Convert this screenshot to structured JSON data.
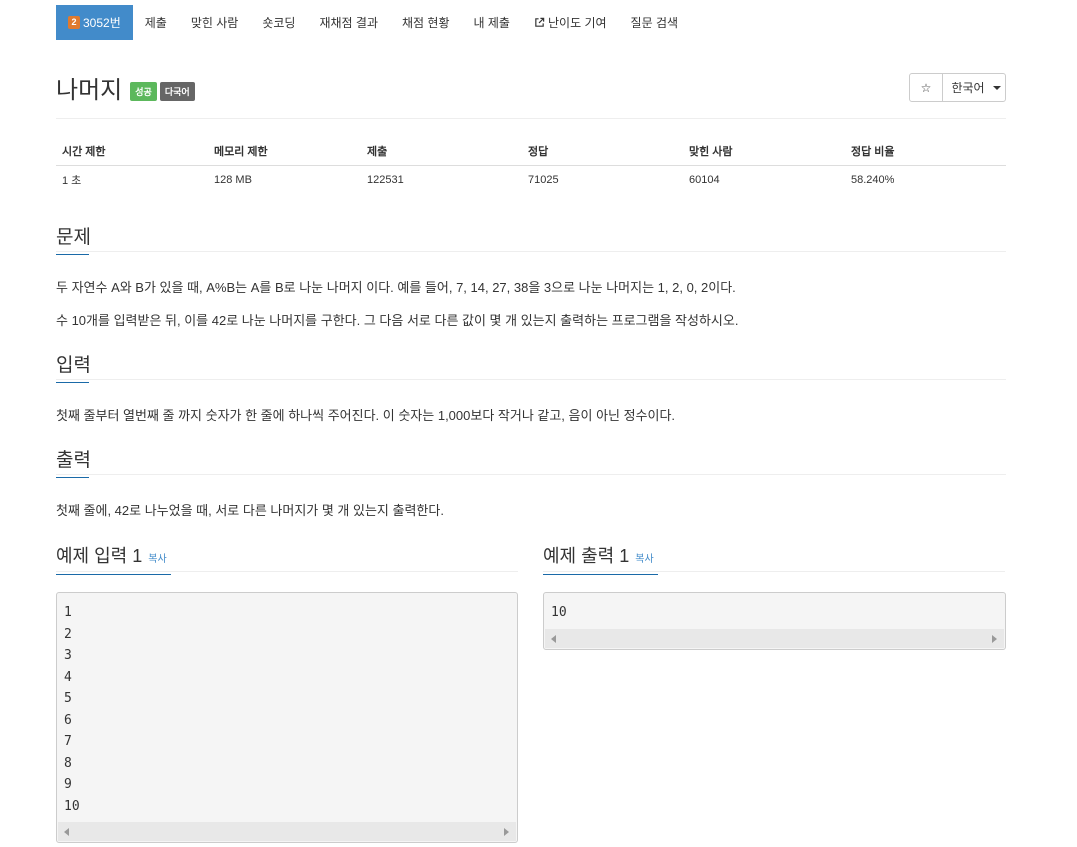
{
  "nav": {
    "problem_tab": "3052번",
    "medal_level": "2",
    "items": [
      "제출",
      "맞힌 사람",
      "숏코딩",
      "재채점 결과",
      "채점 현황",
      "내 제출",
      "난이도 기여",
      "질문 검색"
    ]
  },
  "problem": {
    "title": "나머지",
    "badge_success": "성공",
    "badge_multilang": "다국어",
    "star": "☆",
    "language": "한국어"
  },
  "stats": {
    "headers": [
      "시간 제한",
      "메모리 제한",
      "제출",
      "정답",
      "맞힌 사람",
      "정답 비율"
    ],
    "values": [
      "1 초",
      "128 MB",
      "122531",
      "71025",
      "60104",
      "58.240%"
    ]
  },
  "sections": {
    "problem_heading": "문제",
    "problem_p1": "두 자연수 A와 B가 있을 때, A%B는 A를 B로 나눈 나머지 이다. 예를 들어, 7, 14, 27, 38을 3으로 나눈 나머지는 1, 2, 0, 2이다.",
    "problem_p2": "수 10개를 입력받은 뒤, 이를 42로 나눈 나머지를 구한다. 그 다음 서로 다른 값이 몇 개 있는지 출력하는 프로그램을 작성하시오.",
    "input_heading": "입력",
    "input_p": "첫째 줄부터 열번째 줄 까지 숫자가 한 줄에 하나씩 주어진다. 이 숫자는 1,000보다 작거나 같고, 음이 아닌 정수이다.",
    "output_heading": "출력",
    "output_p": "첫째 줄에, 42로 나누었을 때, 서로 다른 나머지가 몇 개 있는지 출력한다."
  },
  "samples": {
    "input_title": "예제 입력 1",
    "output_title": "예제 출력 1",
    "copy_label": "복사",
    "input_lines": [
      "1",
      "2",
      "3",
      "4",
      "5",
      "6",
      "7",
      "8",
      "9",
      "10"
    ],
    "output_lines": [
      "10"
    ]
  },
  "colors": {
    "accent": "#428bca",
    "success": "#5cb85c",
    "multilang": "#666666",
    "medal": "#e07a2e"
  }
}
